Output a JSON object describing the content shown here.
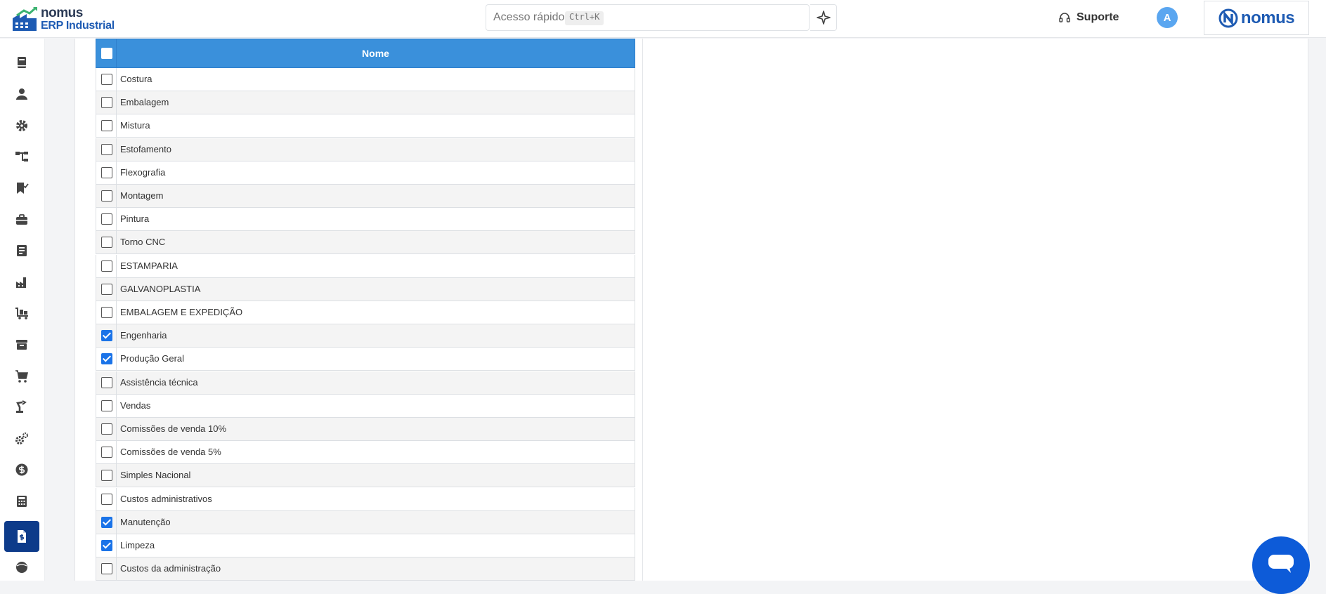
{
  "header": {
    "brand": "nomus",
    "product": "ERP Industrial",
    "quick_access_placeholder": "Acesso rápido",
    "quick_access_shortcut": "Ctrl+K",
    "support_label": "Suporte",
    "avatar_initial": "A",
    "partner_logo_text": "nomus"
  },
  "sidebar": {
    "items": [
      {
        "icon": "book-icon"
      },
      {
        "icon": "user-icon"
      },
      {
        "icon": "gear-icon"
      },
      {
        "icon": "hierarchy-icon"
      },
      {
        "icon": "bookmark-check-icon"
      },
      {
        "icon": "briefcase-icon"
      },
      {
        "icon": "document-icon"
      },
      {
        "icon": "factory-icon"
      },
      {
        "icon": "cart-flatbed-icon"
      },
      {
        "icon": "archive-box-icon"
      },
      {
        "icon": "shopping-cart-icon"
      },
      {
        "icon": "robot-arm-icon"
      },
      {
        "icon": "gears-icon"
      },
      {
        "icon": "dollar-circle-icon"
      },
      {
        "icon": "calculator-icon"
      },
      {
        "icon": "invoice-dollar-icon",
        "active": true
      },
      {
        "icon": "globe-icon"
      }
    ]
  },
  "grid": {
    "column_header": "Nome",
    "rows": [
      {
        "name": "Costura",
        "checked": false
      },
      {
        "name": "Embalagem",
        "checked": false
      },
      {
        "name": "Mistura",
        "checked": false
      },
      {
        "name": "Estofamento",
        "checked": false
      },
      {
        "name": "Flexografia",
        "checked": false
      },
      {
        "name": "Montagem",
        "checked": false
      },
      {
        "name": "Pintura",
        "checked": false
      },
      {
        "name": "Torno CNC",
        "checked": false
      },
      {
        "name": "ESTAMPARIA",
        "checked": false
      },
      {
        "name": "GALVANOPLASTIA",
        "checked": false
      },
      {
        "name": "EMBALAGEM E EXPEDIÇÃO",
        "checked": false
      },
      {
        "name": "Engenharia",
        "checked": true
      },
      {
        "name": "Produção Geral",
        "checked": true
      },
      {
        "name": "Assistência técnica",
        "checked": false
      },
      {
        "name": "Vendas",
        "checked": false
      },
      {
        "name": "Comissões de venda 10%",
        "checked": false
      },
      {
        "name": "Comissões de venda 5%",
        "checked": false
      },
      {
        "name": "Simples Nacional",
        "checked": false
      },
      {
        "name": "Custos administrativos",
        "checked": false
      },
      {
        "name": "Manutenção",
        "checked": true
      },
      {
        "name": "Limpeza",
        "checked": true
      },
      {
        "name": "Custos da administração",
        "checked": false
      }
    ]
  },
  "colors": {
    "accent": "#3a90db",
    "sidebar_active": "#0d3b8a",
    "checkbox_checked": "#1a73e8",
    "chat": "#0d5bd8"
  }
}
